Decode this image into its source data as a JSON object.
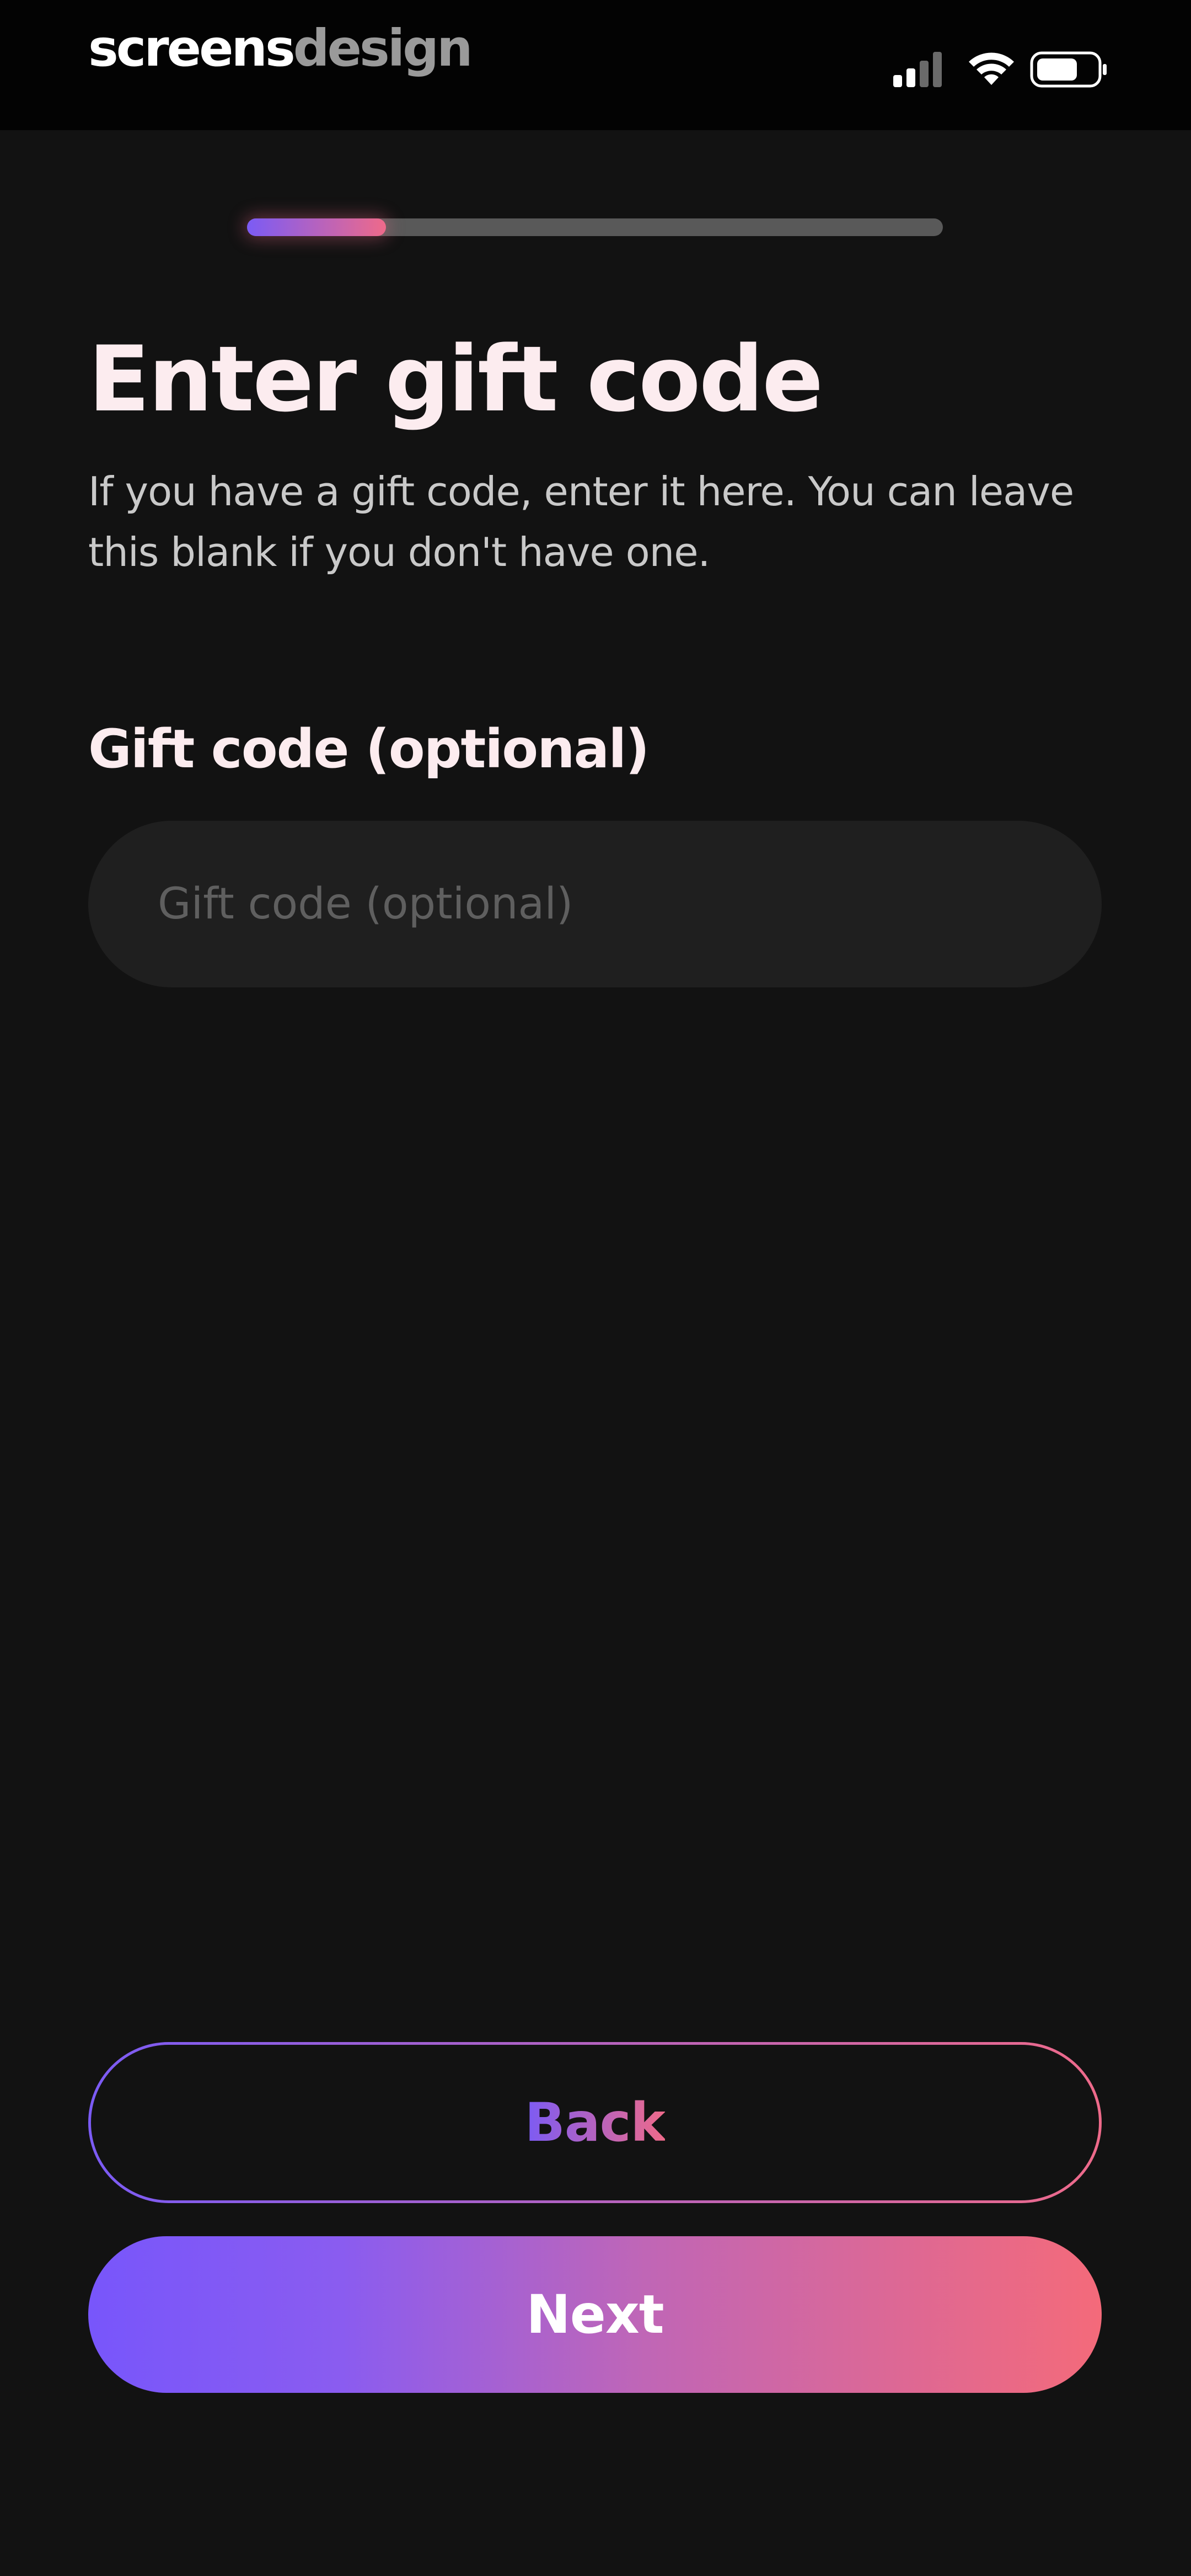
{
  "status_bar": {
    "brand_primary": "screens",
    "brand_secondary": "design",
    "icons": [
      "signal-icon",
      "wifi-icon",
      "battery-icon"
    ]
  },
  "progress": {
    "fraction": 0.2
  },
  "header": {
    "title": "Enter gift code",
    "subtitle": "If you have a gift code, enter it here. You can leave this blank if you don't have one."
  },
  "gift_code": {
    "label": "Gift code (optional)",
    "placeholder": "Gift code (optional)",
    "value": ""
  },
  "actions": {
    "back_label": "Back",
    "next_label": "Next"
  },
  "colors": {
    "background": "#121212",
    "accent_start": "#7b5bf5",
    "accent_end": "#ee6a8a",
    "title": "#fcecef"
  }
}
